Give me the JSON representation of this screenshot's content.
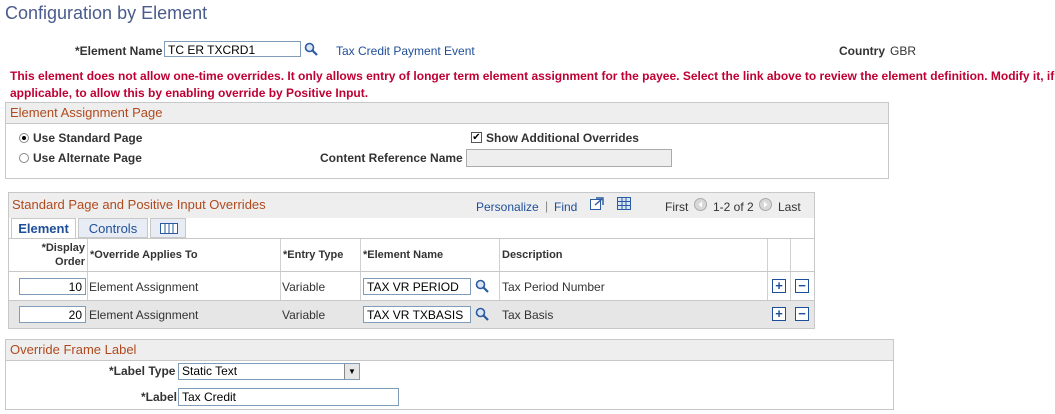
{
  "page_title": "Configuration by Element",
  "element": {
    "label": "*Element Name",
    "value": "TC ER TXCRD1",
    "description_link": "Tax Credit Payment Event"
  },
  "country": {
    "label": "Country",
    "value": "GBR"
  },
  "message_line1": "This element does not allow one-time overrides.  It only allows entry of longer term element assignment for the payee.  Select the link above to review the element definition.  Modify it, if",
  "message_line2": "applicable, to allow this by enabling override by Positive Input.",
  "assignment": {
    "title": "Element Assignment Page",
    "use_standard": "Use Standard Page",
    "use_alternate": "Use Alternate Page",
    "selected": "standard",
    "show_additional": "Show Additional Overrides",
    "show_additional_checked": true,
    "content_ref_label": "Content Reference Name",
    "content_ref_value": ""
  },
  "grid": {
    "title": "Standard Page and Positive Input Overrides",
    "personalize": "Personalize",
    "separator": "|",
    "find": "Find",
    "first": "First",
    "range": "1-2 of 2",
    "last": "Last",
    "tabs": {
      "element": "Element",
      "controls": "Controls"
    },
    "headers": {
      "display_order_1": "*Display",
      "display_order_2": "Order",
      "applies_to": "*Override Applies To",
      "entry_type": "*Entry Type",
      "element_name": "*Element Name",
      "description": "Description"
    },
    "rows": [
      {
        "order": "10",
        "applies_to": "Element Assignment",
        "entry_type": "Variable",
        "element_name": "TAX VR PERIOD",
        "description": "Tax Period Number"
      },
      {
        "order": "20",
        "applies_to": "Element Assignment",
        "entry_type": "Variable",
        "element_name": "TAX VR TXBASIS",
        "description": "Tax Basis"
      }
    ]
  },
  "frame_label": {
    "title": "Override Frame Label",
    "label_type_label": "*Label Type",
    "label_type_value": "Static Text",
    "label_label": "*Label",
    "label_value": "Tax Credit"
  },
  "colors": {
    "title": "#4a5c8c",
    "link": "#1f4e98",
    "error": "#c00033",
    "section_title": "#b04a1e",
    "band": "#e8e8e8"
  },
  "icons": [
    "search-icon",
    "view-all-icon",
    "download-icon",
    "prev-icon",
    "next-icon",
    "add-row-icon",
    "delete-row-icon",
    "dropdown-icon"
  ]
}
